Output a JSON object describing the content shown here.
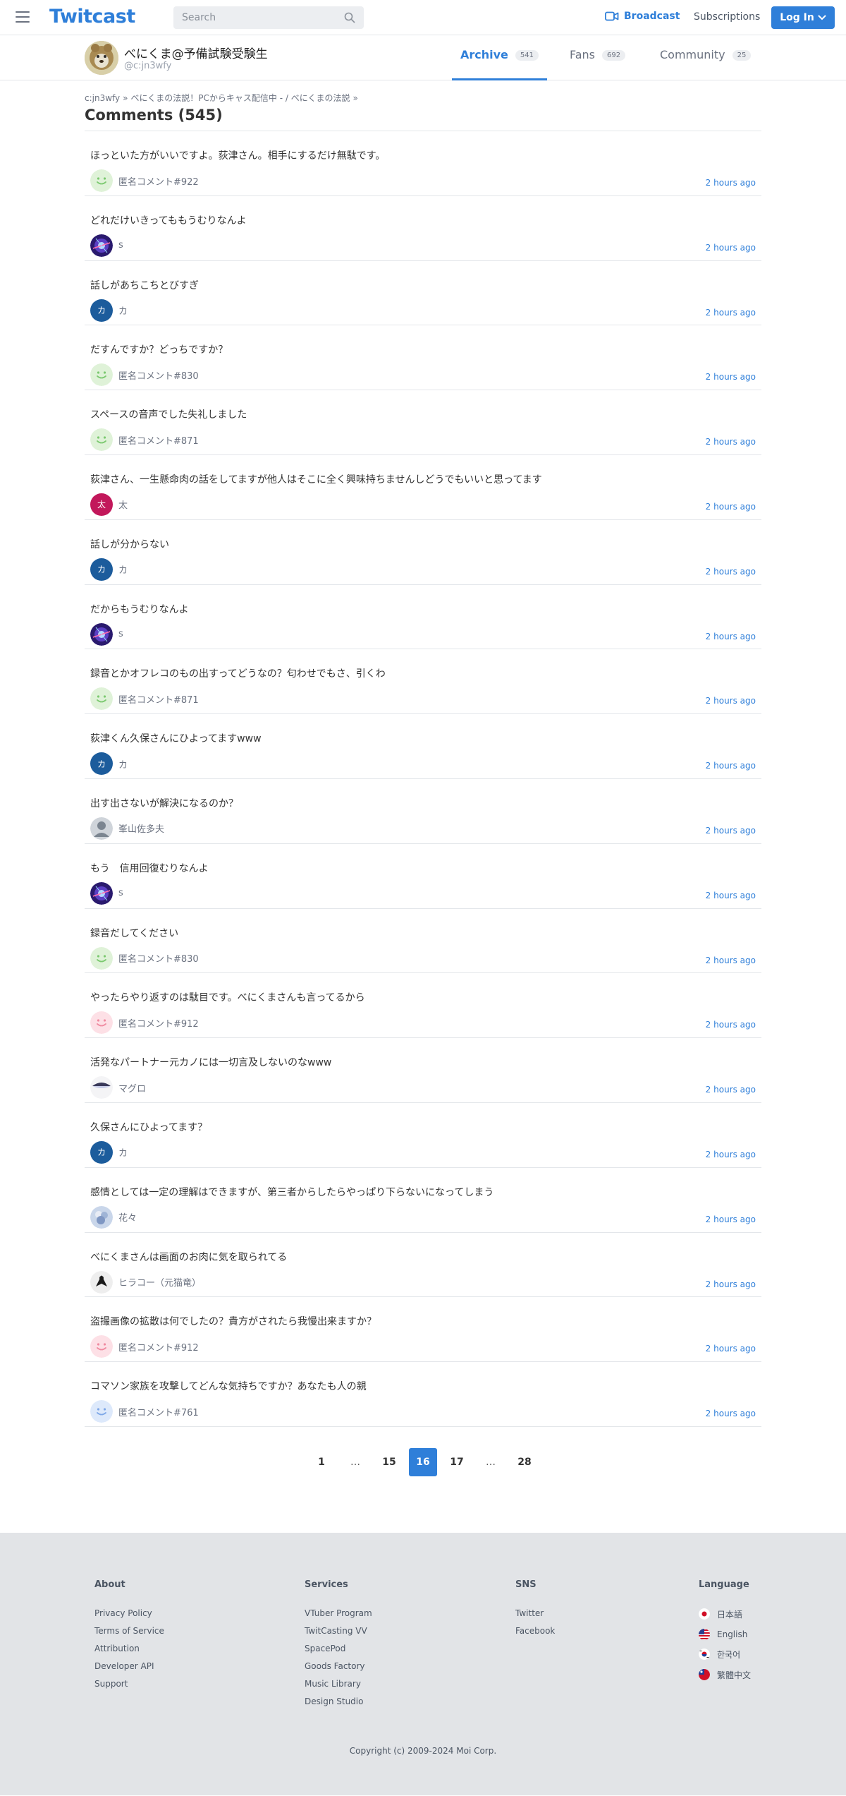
{
  "header": {
    "logo": "Twitcast",
    "search_placeholder": "Search",
    "broadcast": "Broadcast",
    "subscriptions": "Subscriptions",
    "login": "Log In"
  },
  "profile": {
    "name": "べにくま@予備試験受験生",
    "id": "@c:jn3wfy",
    "tabs": [
      {
        "label": "Archive",
        "count": "541"
      },
      {
        "label": "Fans",
        "count": "692"
      },
      {
        "label": "Community",
        "count": "25"
      }
    ]
  },
  "breadcrumb": [
    "c:jn3wfy",
    "べにくまの法説！PCからキャス配信中 - / べにくまの法説"
  ],
  "comments_title": "Comments",
  "comments_count": "(545)",
  "comments": [
    {
      "text": "ほっといた方がいいですよ。荻津さん。相手にするだけ無駄です。",
      "author": "匿名コメント#922",
      "time": "2 hours ago",
      "avatar": "smile-green"
    },
    {
      "text": "どれだけいきってももうむりなんよ",
      "author": "s",
      "time": "2 hours ago",
      "avatar": "galaxy"
    },
    {
      "text": "話しがあちこちとびすぎ",
      "author": "カ",
      "time": "2 hours ago",
      "avatar": "letter-blue",
      "initial": "カ"
    },
    {
      "text": "だすんですか？どっちですか？",
      "author": "匿名コメント#830",
      "time": "2 hours ago",
      "avatar": "smile-green"
    },
    {
      "text": "スペースの音声でした失礼しました",
      "author": "匿名コメント#871",
      "time": "2 hours ago",
      "avatar": "smile-green"
    },
    {
      "text": "荻津さん、一生懸命肉の話をしてますが他人はそこに全く興味持ちませんしどうでもいいと思ってます",
      "author": "太",
      "time": "2 hours ago",
      "avatar": "letter-red",
      "initial": "太"
    },
    {
      "text": "話しが分からない",
      "author": "カ",
      "time": "2 hours ago",
      "avatar": "letter-blue",
      "initial": "カ"
    },
    {
      "text": "だからもうむりなんよ",
      "author": "s",
      "time": "2 hours ago",
      "avatar": "galaxy"
    },
    {
      "text": "録音とかオフレコのもの出すってどうなの？匂わせでもさ、引くわ",
      "author": "匿名コメント#871",
      "time": "2 hours ago",
      "avatar": "smile-green"
    },
    {
      "text": "荻津くん久保さんにひよってますwww",
      "author": "カ",
      "time": "2 hours ago",
      "avatar": "letter-blue",
      "initial": "カ"
    },
    {
      "text": "出す出さないが解決になるのか？",
      "author": "峯山佐多夫",
      "time": "2 hours ago",
      "avatar": "person-gray"
    },
    {
      "text": "もう　信用回復むりなんよ",
      "author": "s",
      "time": "2 hours ago",
      "avatar": "galaxy"
    },
    {
      "text": "録音だしてください",
      "author": "匿名コメント#830",
      "time": "2 hours ago",
      "avatar": "smile-green"
    },
    {
      "text": "やったらやり返すのは駄目です。べにくまさんも言ってるから",
      "author": "匿名コメント#912",
      "time": "2 hours ago",
      "avatar": "smile-pink"
    },
    {
      "text": "活発なパートナー元カノには一切言及しないのなwww",
      "author": "マグロ",
      "time": "2 hours ago",
      "avatar": "fish"
    },
    {
      "text": "久保さんにひよってます？",
      "author": "カ",
      "time": "2 hours ago",
      "avatar": "letter-blue",
      "initial": "カ"
    },
    {
      "text": "感情としては一定の理解はできますが、第三者からしたらやっぱり下らないになってしまう",
      "author": "花々",
      "time": "2 hours ago",
      "avatar": "flower"
    },
    {
      "text": "べにくまさんは画面のお肉に気を取られてる",
      "author": "ヒラコー（元猫竜）",
      "time": "2 hours ago",
      "avatar": "bird"
    },
    {
      "text": "盗撮画像の拡散は何でしたの？貴方がされたら我慢出来ますか？",
      "author": "匿名コメント#912",
      "time": "2 hours ago",
      "avatar": "smile-pink"
    },
    {
      "text": "コマソン家族を攻撃してどんな気持ちですか？あなたも人の親",
      "author": "匿名コメント#761",
      "time": "2 hours ago",
      "avatar": "smile-blue"
    }
  ],
  "pagination": [
    "1",
    "…",
    "15",
    "16",
    "17",
    "…",
    "28"
  ],
  "pagination_active": "16",
  "footer": {
    "about": {
      "title": "About",
      "links": [
        "Privacy Policy",
        "Terms of Service",
        "Attribution",
        "Developer API",
        "Support"
      ]
    },
    "services": {
      "title": "Services",
      "links": [
        "VTuber Program",
        "TwitCasting VV",
        "SpacePod",
        "Goods Factory",
        "Music Library",
        "Design Studio"
      ]
    },
    "sns": {
      "title": "SNS",
      "links": [
        "Twitter",
        "Facebook"
      ]
    },
    "language": {
      "title": "Language",
      "items": [
        {
          "label": "日本語",
          "flag": "japan-flag-icon"
        },
        {
          "label": "English",
          "flag": "us-flag-icon"
        },
        {
          "label": "한국어",
          "flag": "korea-flag-icon"
        },
        {
          "label": "繁體中文",
          "flag": "taiwan-flag-icon"
        }
      ]
    },
    "copyright": "Copyright (c) 2009-2024 Moi Corp."
  },
  "colors": {
    "accent": "#2f7fd9",
    "footer_bg": "#e2e4e7",
    "divider": "#e3e6ea"
  }
}
